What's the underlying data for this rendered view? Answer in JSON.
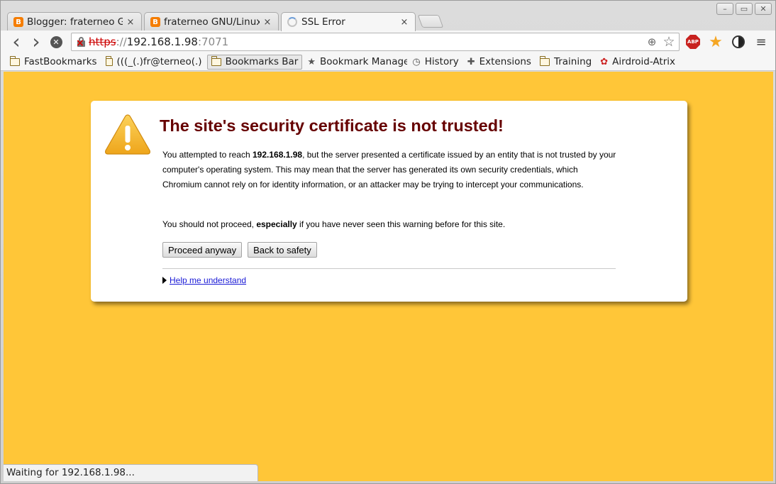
{
  "tabs": [
    {
      "title": "Blogger: fraterneo GN",
      "favicon": "blogger-icon",
      "active": false
    },
    {
      "title": "fraterneo GNU/Linux:",
      "favicon": "blogger-icon",
      "active": false
    },
    {
      "title": "SSL Error",
      "favicon": "loading-spinner-icon",
      "active": true
    }
  ],
  "tab_close_glyph": "×",
  "favicon_letter": "B",
  "window_controls": {
    "minimize": "–",
    "restore": "▭",
    "close": "✕"
  },
  "toolbar": {
    "back_icon": "‹",
    "forward_icon": "›",
    "stop_icon": "✕",
    "url": {
      "scheme": "https",
      "separator": "://",
      "host": "192.168.1.98",
      "port": ":7071"
    },
    "zoom_icon": "⊕",
    "bookmark_star_icon": "☆",
    "abp_label": "ABP",
    "starred_icon": "★",
    "menu_icon": "≡"
  },
  "bookmarks": [
    {
      "label": "FastBookmarks",
      "icon": "folder-icon"
    },
    {
      "label": "(((_(.)fr@terneo(.)",
      "icon": "folder-icon"
    },
    {
      "label": "Bookmarks Bar",
      "icon": "folder-icon"
    },
    {
      "label": "Bookmark Manager",
      "icon": "star-icon",
      "glyph": "★"
    },
    {
      "label": "History",
      "icon": "clock-icon",
      "glyph": "◷"
    },
    {
      "label": "Extensions",
      "icon": "puzzle-icon",
      "glyph": "✚"
    },
    {
      "label": "Training",
      "icon": "folder-icon"
    },
    {
      "label": "Airdroid-Atrix",
      "icon": "airdroid-icon",
      "glyph": "✿"
    }
  ],
  "page": {
    "title": "The site's security certificate is not trusted!",
    "p1_before": "You attempted to reach ",
    "p1_host": "192.168.1.98",
    "p1_after": ", but the server presented a certificate issued by an entity that is not trusted by your computer's operating system. This may mean that the server has generated its own security credentials, which Chromium cannot rely on for identity information, or an attacker may be trying to intercept your communications.",
    "p2_before": "You should not proceed, ",
    "p2_bold": "especially",
    "p2_after": " if you have never seen this warning before for this site.",
    "proceed_label": "Proceed anyway",
    "back_label": "Back to safety",
    "help_label": "Help me understand"
  },
  "status_text": "Waiting for 192.168.1.98...",
  "colors": {
    "page_background": "#ffc638",
    "title": "#660000",
    "link": "#1a1ad6",
    "warning_icon": "#f5b82e"
  }
}
